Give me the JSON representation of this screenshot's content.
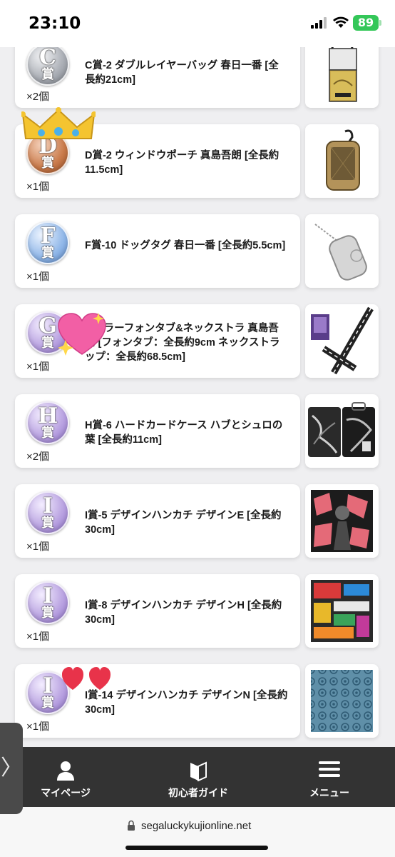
{
  "status_bar": {
    "time": "23:10",
    "battery": "89"
  },
  "prizes": [
    {
      "rank_letter": "C",
      "rank_kanji": "賞",
      "name": "C賞-2 ダブルレイヤーバッグ 春日一番 [全長約21cm]",
      "qty": "×2個",
      "badge_color": "#a8acb3"
    },
    {
      "rank_letter": "D",
      "rank_kanji": "賞",
      "name": "D賞-2 ウィンドウポーチ 真島吾朗 [全長約11.5cm]",
      "qty": "×1個",
      "badge_color": "#c97a4a"
    },
    {
      "rank_letter": "F",
      "rank_kanji": "賞",
      "name": "F賞-10 ドッグタグ 春日一番 [全長約5.5cm]",
      "qty": "×1個",
      "badge_color": "#8fb6e8"
    },
    {
      "rank_letter": "G",
      "rank_kanji": "賞",
      "name": "3 カラーフォンタブ&ネックストラ 真島吾朗 [フォンタブ：全長約9cm ネックストラップ：全長約68.5cm]",
      "qty": "×1個",
      "badge_color": "#b7a0e0"
    },
    {
      "rank_letter": "H",
      "rank_kanji": "賞",
      "name": "H賞-6 ハードカードケース ハブとシュロの葉 [全長約11cm]",
      "qty": "×2個",
      "badge_color": "#b7a0e0"
    },
    {
      "rank_letter": "I",
      "rank_kanji": "賞",
      "name": "I賞-5 デザインハンカチ デザインE [全長約30cm]",
      "qty": "×1個",
      "badge_color": "#b7a0e0"
    },
    {
      "rank_letter": "I",
      "rank_kanji": "賞",
      "name": "I賞-8 デザインハンカチ デザインH [全長約30cm]",
      "qty": "×1個",
      "badge_color": "#b7a0e0"
    },
    {
      "rank_letter": "I",
      "rank_kanji": "賞",
      "name": "I賞-14 デザインハンカチ デザインN [全長約30cm]",
      "qty": "×1個",
      "badge_color": "#b7a0e0"
    }
  ],
  "bottom_nav": {
    "mypage_label": "マイページ",
    "guide_label": "初心者ガイド",
    "menu_label": "メニュー"
  },
  "side_tab": {
    "glyph": "〉"
  },
  "url_bar": {
    "domain": "segaluckykujionline.net"
  }
}
